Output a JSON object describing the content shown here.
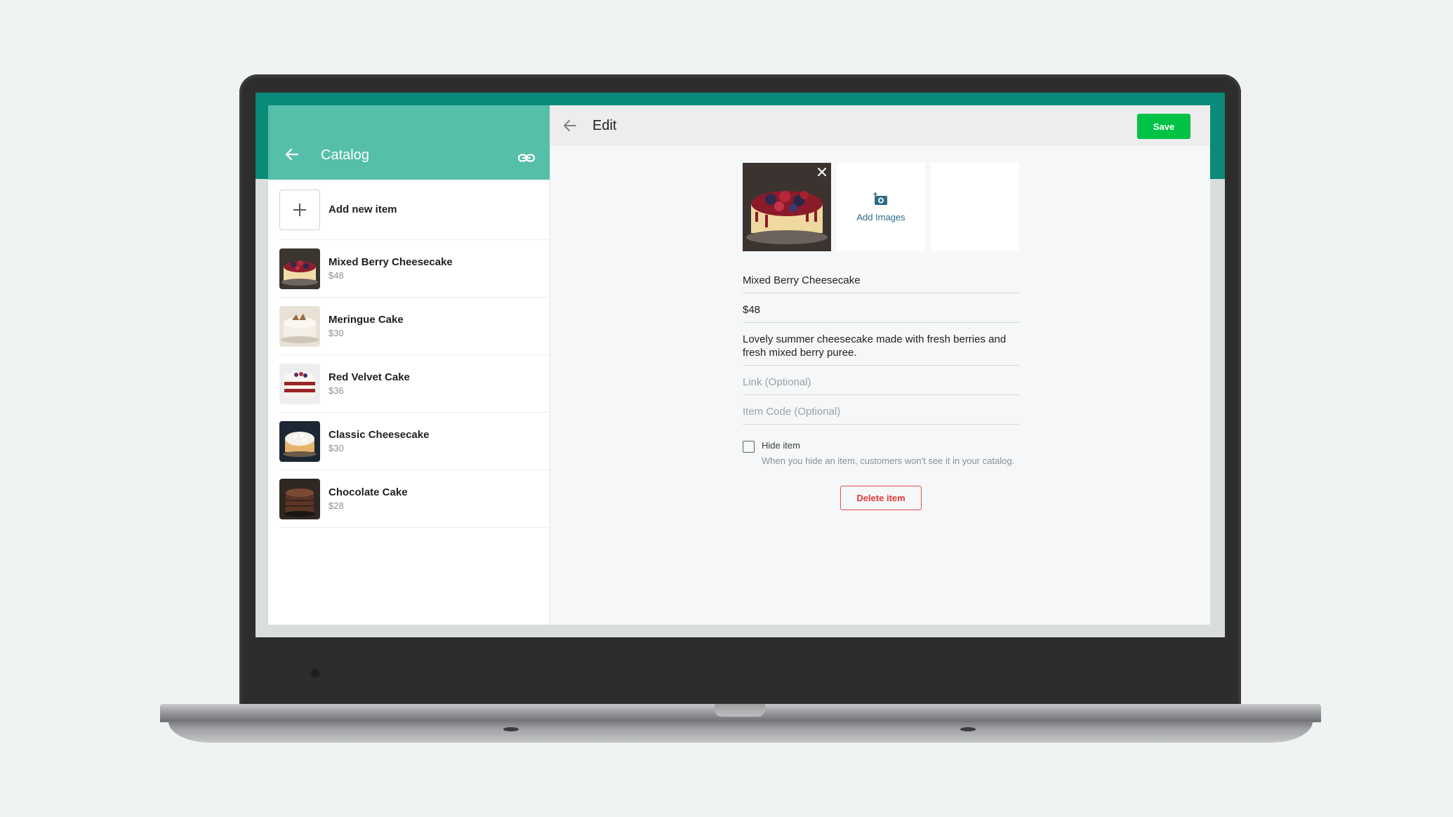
{
  "catalog": {
    "title": "Catalog",
    "add_item_label": "Add new item",
    "items": [
      {
        "name": "Mixed Berry Cheesecake",
        "price": "$48"
      },
      {
        "name": "Meringue Cake",
        "price": "$30"
      },
      {
        "name": "Red Velvet Cake",
        "price": "$36"
      },
      {
        "name": "Classic Cheesecake",
        "price": "$30"
      },
      {
        "name": "Chocolate Cake",
        "price": "$28"
      }
    ]
  },
  "edit": {
    "title": "Edit",
    "save_label": "Save",
    "add_images_label": "Add Images",
    "name_value": "Mixed Berry Cheesecake",
    "price_value": "$48",
    "description_value": "Lovely summer cheesecake made with fresh berries and fresh mixed berry puree.",
    "link_placeholder": "Link (Optional)",
    "item_code_placeholder": "Item Code (Optional)",
    "hide_item_label": "Hide item",
    "hide_item_description": "When you hide an item, customers won't see it in your catalog.",
    "hide_item_checked": false,
    "delete_label": "Delete item"
  },
  "colors": {
    "header_teal": "#55bfa9",
    "screen_top_teal": "#0a8a78",
    "save_green": "#00c244",
    "delete_red": "#e23b3b",
    "add_images_blue": "#2c6b87"
  },
  "icons": [
    "back-arrow-icon",
    "link-icon",
    "plus-icon",
    "add-photo-camera-icon",
    "close-icon"
  ]
}
